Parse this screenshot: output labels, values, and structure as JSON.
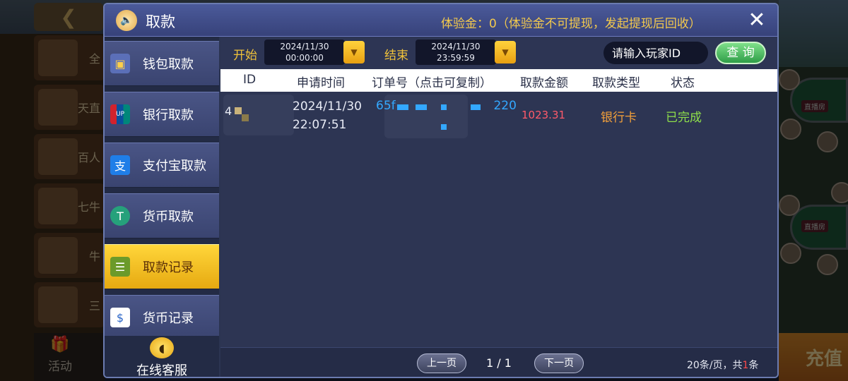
{
  "background": {
    "activity_label": "活动",
    "recharge_label": "充值",
    "games": [
      "全",
      "天直",
      "百人",
      "七牛",
      "牛",
      "三"
    ]
  },
  "dialog": {
    "title": "取款",
    "notice_label": "体验金：",
    "notice_value": "0",
    "notice_detail": "（体验金不可提现，发起提现后回收）",
    "close_icon": "close-icon"
  },
  "sidebar": {
    "items": [
      {
        "label": "钱包取款",
        "icon": "wallet-icon",
        "active": false
      },
      {
        "label": "银行取款",
        "icon": "unionpay-icon",
        "active": false
      },
      {
        "label": "支付宝取款",
        "icon": "alipay-icon",
        "active": false
      },
      {
        "label": "货币取款",
        "icon": "tether-icon",
        "active": false
      },
      {
        "label": "取款记录",
        "icon": "clipboard-icon",
        "active": true
      },
      {
        "label": "货币记录",
        "icon": "currency-record-icon",
        "active": false
      }
    ],
    "support_label": "在线客服"
  },
  "filter": {
    "start_label": "开始",
    "start_date": "2024/11/30",
    "start_time": "00:00:00",
    "end_label": "结束",
    "end_date": "2024/11/30",
    "end_time": "23:59:59",
    "player_placeholder": "请输入玩家ID",
    "query_label": "查 询"
  },
  "table": {
    "columns": [
      "ID",
      "申请时间",
      "订单号（点击可复制）",
      "取款金额",
      "取款类型",
      "状态"
    ],
    "rows": [
      {
        "id": "4",
        "apply_date": "2024/11/30",
        "apply_time": "22:07:51",
        "order_prefix": "65f",
        "order_suffix": "220",
        "amount": "1023.31",
        "type": "银行卡",
        "status": "已完成"
      }
    ]
  },
  "pagination": {
    "prev_label": "上一页",
    "next_label": "下一页",
    "page": "1 / 1",
    "per_page_text": "20条/页，共",
    "total": "1",
    "total_suffix": "条"
  },
  "colors": {
    "accent_gold": "#f0c23a",
    "amount_red": "#ff5a6a",
    "type_orange": "#f3a03a",
    "status_green": "#8fe04a",
    "order_blue": "#33a8ff"
  }
}
